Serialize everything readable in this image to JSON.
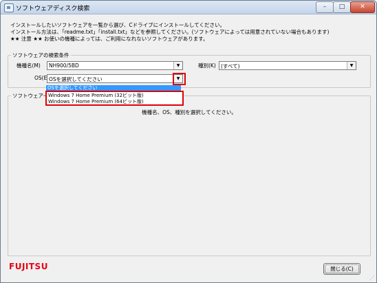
{
  "window": {
    "title": "ソフトウェアディスク検索",
    "min_glyph": "–",
    "max_glyph": "□",
    "close_glyph": "✕"
  },
  "intro": {
    "line1": "インストールしたいソフトウェアを一覧から選び、Cドライブにインストールしてください。",
    "line2": "インストール方法は、「readme.txt」「install.txt」などを参照してください。(ソフトウェアによっては用意されていない場合もあります)",
    "line3": "★★ 注意 ★★ お使いの機種によっては、ご利用になれないソフトウェアがあります。"
  },
  "conditions": {
    "group_title": "ソフトウェアの検索条件",
    "model_label": "機種名(M)",
    "model_value": "NH900/5BD",
    "type_label": "種別(K)",
    "type_value": "(すべて)",
    "os_label": "OS(E)",
    "os_value": "OSを選択してください",
    "os_options": [
      "OSを選択してください",
      "Windows 7 Home Premium (32ビット版)",
      "Windows 7 Home Premium (64ビット版)"
    ],
    "arrow_glyph": "▼"
  },
  "software": {
    "group_title": "ソフトウェア一覧",
    "message": "機種名、OS、種別を選択してください。"
  },
  "footer": {
    "logo_text": "FUJITSU",
    "close_button_label": "閉じる(C)"
  }
}
